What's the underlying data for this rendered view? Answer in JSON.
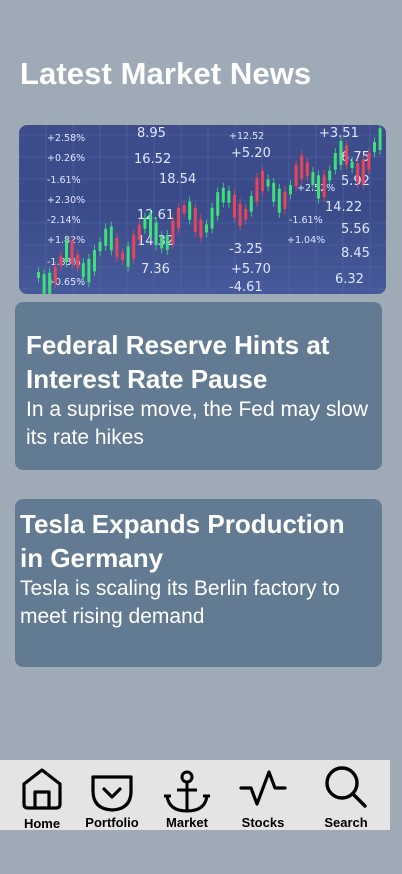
{
  "page": {
    "title": "Latest Market News"
  },
  "hero": {
    "alt": "stock-chart",
    "colors": {
      "bg": "#3e4c8c",
      "up": "#3ee07a",
      "down": "#e8455a",
      "text": "#dfe6ff"
    },
    "ticker_labels": [
      "+2.58%",
      "+0.26%",
      "-1.61%",
      "+2.30%",
      "-2.14%",
      "+1.82%",
      "-1.83%",
      "+0.65%",
      "8.95",
      "16.52",
      "18.54",
      "12.61",
      "14.32",
      "7.36",
      "+12.52",
      "+5.20",
      "-3.25",
      "-4.61",
      "+5.70",
      "+1.04%",
      "-1.61%",
      "+2.52%",
      "+3.51",
      "6.75",
      "5.92",
      "14.22",
      "5.56",
      "8.45",
      "6.32"
    ]
  },
  "news": [
    {
      "headline": "Federal Reserve Hints at Interest Rate Pause",
      "summary": "In a suprise move, the Fed may slow its rate hikes"
    },
    {
      "headline": "Tesla Expands Production in Germany",
      "summary": "Tesla is scaling its Berlin factory to meet rising demand"
    }
  ],
  "nav": {
    "items": [
      {
        "label": "Home",
        "icon": "home-icon"
      },
      {
        "label": "Portfolio",
        "icon": "pocket-icon"
      },
      {
        "label": "Market",
        "icon": "anchor-icon"
      },
      {
        "label": "Stocks",
        "icon": "activity-icon"
      },
      {
        "label": "Search",
        "icon": "search-icon"
      }
    ]
  },
  "colors": {
    "background": "#9eabb6",
    "card": "#637b92",
    "navbar": "#e4e4e4"
  }
}
